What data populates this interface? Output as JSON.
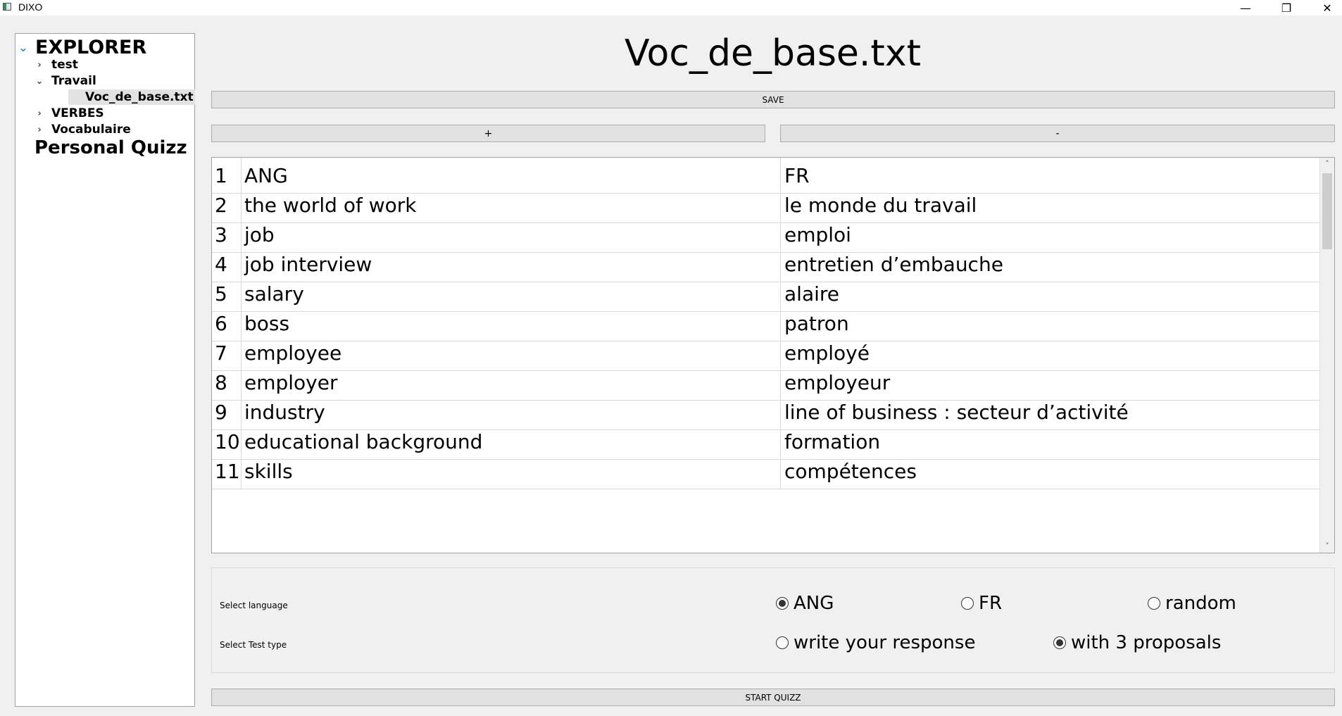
{
  "window": {
    "title": "DIXO",
    "minimize_glyph": "—",
    "maximize_glyph": "❐",
    "close_glyph": "✕"
  },
  "explorer": {
    "root_label": "EXPLORER",
    "items": [
      {
        "label": "test",
        "expanded": false
      },
      {
        "label": "Travail",
        "expanded": true
      },
      {
        "label": "VERBES",
        "expanded": false
      },
      {
        "label": "Vocabulaire",
        "expanded": false
      }
    ],
    "selected_file": "Voc_de_base.txt",
    "personal_quiz": "Personal Quizz"
  },
  "file_title": "Voc_de_base.txt",
  "buttons": {
    "save": "SAVE",
    "add": "+",
    "remove": "-",
    "start": "START QUIZZ"
  },
  "table": {
    "rows": [
      {
        "num": "1",
        "ang": "ANG",
        "fr": "FR"
      },
      {
        "num": "2",
        "ang": "the world of work",
        "fr": "le monde du travail"
      },
      {
        "num": "3",
        "ang": "job",
        "fr": "emploi"
      },
      {
        "num": "4",
        "ang": "job interview",
        "fr": "entretien d’embauche"
      },
      {
        "num": "5",
        "ang": "salary",
        "fr": "alaire"
      },
      {
        "num": "6",
        "ang": "boss",
        "fr": "patron"
      },
      {
        "num": "7",
        "ang": "employee",
        "fr": "employé"
      },
      {
        "num": "8",
        "ang": "employer",
        "fr": "employeur"
      },
      {
        "num": "9",
        "ang": "industry",
        "fr": "line of business : secteur d’activité"
      },
      {
        "num": "10",
        "ang": "educational background",
        "fr": "formation"
      },
      {
        "num": "11",
        "ang": "skills",
        "fr": "compétences"
      }
    ]
  },
  "options": {
    "language_label": "Select language",
    "language_options": [
      {
        "label": "ANG",
        "checked": true
      },
      {
        "label": "FR",
        "checked": false
      },
      {
        "label": "random",
        "checked": false
      }
    ],
    "test_type_label": "Select Test type",
    "test_type_options": [
      {
        "label": "write your response",
        "checked": false
      },
      {
        "label": "with 3 proposals",
        "checked": true
      }
    ]
  }
}
